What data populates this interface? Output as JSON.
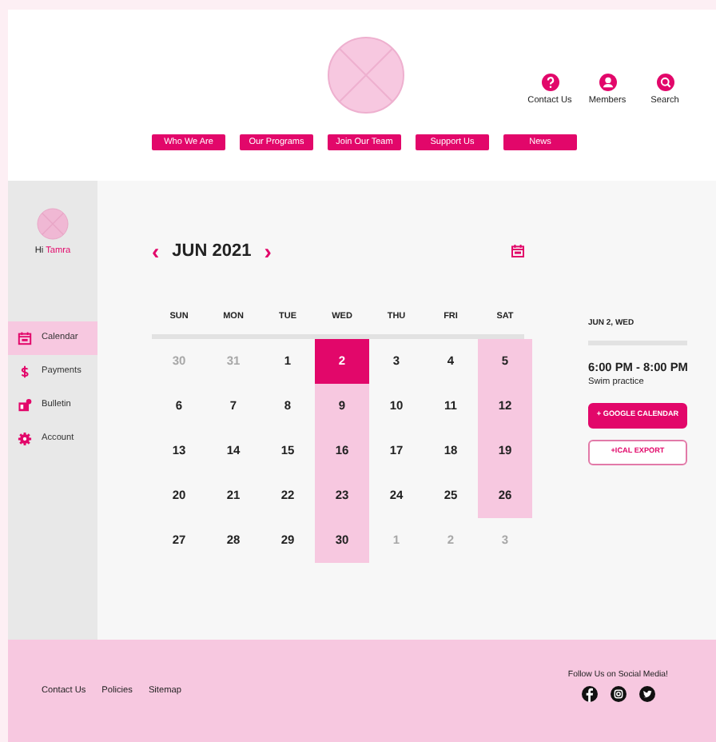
{
  "header": {
    "utilities": [
      {
        "label": "Contact Us"
      },
      {
        "label": "Members"
      },
      {
        "label": "Search"
      }
    ],
    "nav": [
      "Who We Are",
      "Our Programs",
      "Join Our Team",
      "Support Us",
      "News"
    ]
  },
  "sidebar": {
    "greeting": "Hi",
    "user_name": "Tamra",
    "items": [
      {
        "label": "Calendar",
        "selected": true
      },
      {
        "label": "Payments",
        "selected": false
      },
      {
        "label": "Bulletin",
        "selected": false
      },
      {
        "label": "Account",
        "selected": false
      }
    ]
  },
  "calendar": {
    "prev": "‹",
    "month": "JUN 2021",
    "next": "›",
    "weekdays": [
      "SUN",
      "MON",
      "TUE",
      "WED",
      "THU",
      "FRI",
      "SAT"
    ],
    "weeks": [
      [
        {
          "day": "30",
          "muted": true,
          "selected": false,
          "highlighted": false
        },
        {
          "day": "31",
          "muted": true,
          "selected": false,
          "highlighted": false
        },
        {
          "day": "1",
          "muted": false,
          "selected": false,
          "highlighted": false
        },
        {
          "day": "2",
          "muted": false,
          "selected": true,
          "highlighted": false
        },
        {
          "day": "3",
          "muted": false,
          "selected": false,
          "highlighted": false
        },
        {
          "day": "4",
          "muted": false,
          "selected": false,
          "highlighted": false
        },
        {
          "day": "5",
          "muted": false,
          "selected": false,
          "highlighted": true
        }
      ],
      [
        {
          "day": "6",
          "muted": false,
          "selected": false,
          "highlighted": false
        },
        {
          "day": "7",
          "muted": false,
          "selected": false,
          "highlighted": false
        },
        {
          "day": "8",
          "muted": false,
          "selected": false,
          "highlighted": false
        },
        {
          "day": "9",
          "muted": false,
          "selected": false,
          "highlighted": true
        },
        {
          "day": "10",
          "muted": false,
          "selected": false,
          "highlighted": false
        },
        {
          "day": "11",
          "muted": false,
          "selected": false,
          "highlighted": false
        },
        {
          "day": "12",
          "muted": false,
          "selected": false,
          "highlighted": true
        }
      ],
      [
        {
          "day": "13",
          "muted": false,
          "selected": false,
          "highlighted": false
        },
        {
          "day": "14",
          "muted": false,
          "selected": false,
          "highlighted": false
        },
        {
          "day": "15",
          "muted": false,
          "selected": false,
          "highlighted": false
        },
        {
          "day": "16",
          "muted": false,
          "selected": false,
          "highlighted": true
        },
        {
          "day": "17",
          "muted": false,
          "selected": false,
          "highlighted": false
        },
        {
          "day": "18",
          "muted": false,
          "selected": false,
          "highlighted": false
        },
        {
          "day": "19",
          "muted": false,
          "selected": false,
          "highlighted": true
        }
      ],
      [
        {
          "day": "20",
          "muted": false,
          "selected": false,
          "highlighted": false
        },
        {
          "day": "21",
          "muted": false,
          "selected": false,
          "highlighted": false
        },
        {
          "day": "22",
          "muted": false,
          "selected": false,
          "highlighted": false
        },
        {
          "day": "23",
          "muted": false,
          "selected": false,
          "highlighted": true
        },
        {
          "day": "24",
          "muted": false,
          "selected": false,
          "highlighted": false
        },
        {
          "day": "25",
          "muted": false,
          "selected": false,
          "highlighted": false
        },
        {
          "day": "26",
          "muted": false,
          "selected": false,
          "highlighted": true
        }
      ],
      [
        {
          "day": "27",
          "muted": false,
          "selected": false,
          "highlighted": false
        },
        {
          "day": "28",
          "muted": false,
          "selected": false,
          "highlighted": false
        },
        {
          "day": "29",
          "muted": false,
          "selected": false,
          "highlighted": false
        },
        {
          "day": "30",
          "muted": false,
          "selected": false,
          "highlighted": true
        },
        {
          "day": "1",
          "muted": true,
          "selected": false,
          "highlighted": false
        },
        {
          "day": "2",
          "muted": true,
          "selected": false,
          "highlighted": false
        },
        {
          "day": "3",
          "muted": true,
          "selected": false,
          "highlighted": false
        }
      ]
    ]
  },
  "event_panel": {
    "date": "JUN 2, WED",
    "time": "6:00 PM - 8:00 PM",
    "title": "Swim practice",
    "buttons": [
      {
        "label": "+ GOOGLE CALENDAR",
        "kind": "filled"
      },
      {
        "label": "+ICAL EXPORT",
        "kind": "outline"
      }
    ]
  },
  "footer": {
    "links": [
      "Contact Us",
      "Policies",
      "Sitemap"
    ],
    "social_heading": "Follow Us on Social Media!"
  }
}
